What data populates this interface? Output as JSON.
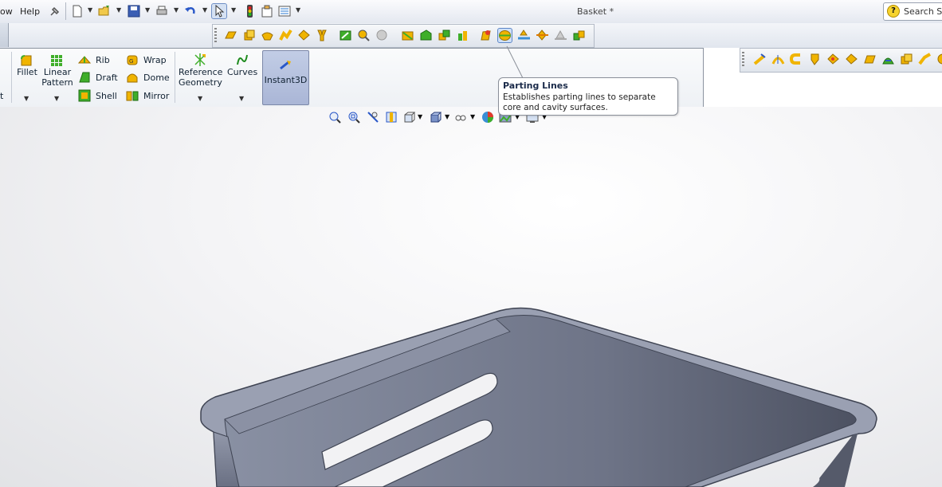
{
  "menubar": {
    "items": [
      "ow",
      "Help"
    ],
    "document_title": "Basket *",
    "search_placeholder": "Search So"
  },
  "commandmanager": {
    "left_cut_label": "t",
    "fillet": "Fillet",
    "linear_pattern": "Linear Pattern",
    "rib": "Rib",
    "draft": "Draft",
    "shell": "Shell",
    "wrap": "Wrap",
    "dome": "Dome",
    "mirror": "Mirror",
    "reference_geometry": "Reference Geometry",
    "curves": "Curves",
    "instant3d": "Instant3D"
  },
  "tooltip": {
    "title": "Parting Lines",
    "description": "Establishes parting lines to separate core and cavity surfaces."
  },
  "colors": {
    "accent_icon": "#f0b400",
    "green_icon": "#3fae2a",
    "model_body": "#7b8296",
    "model_dark": "#4f5566"
  }
}
